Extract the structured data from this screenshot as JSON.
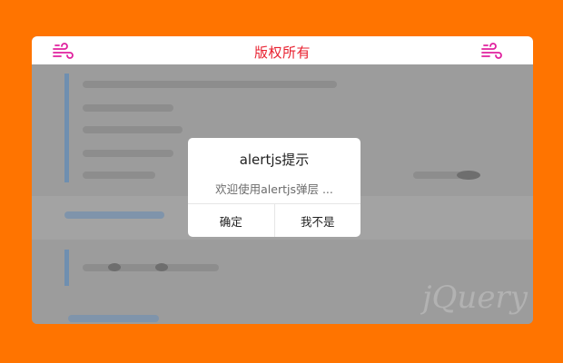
{
  "header": {
    "title": "版权所有",
    "left_icon": "wind-icon",
    "right_icon": "wind-icon",
    "title_color": "#e8202f",
    "icon_color": "#e0209e"
  },
  "dialog": {
    "title": "alertjs提示",
    "message": "欢迎使用alertjs弹层 ...",
    "confirm_label": "确定",
    "cancel_label": "我不是"
  },
  "colors": {
    "page_background": "#ff7400",
    "overlay": "#9a9a9a"
  }
}
